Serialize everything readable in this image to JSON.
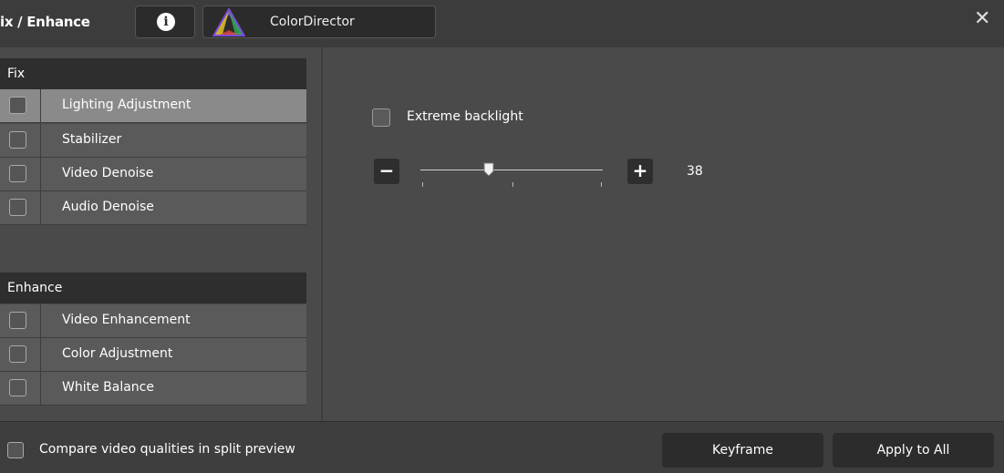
{
  "header": {
    "title": "ix / Enhance",
    "info_icon": "info-icon",
    "info_glyph": "i",
    "colordirector_label": "ColorDirector",
    "close_glyph": "✕"
  },
  "fix_section": {
    "header": "Fix",
    "items": [
      {
        "label": "Lighting Adjustment",
        "checked": false,
        "selected": true
      },
      {
        "label": "Stabilizer",
        "checked": false,
        "selected": false
      },
      {
        "label": "Video Denoise",
        "checked": false,
        "selected": false
      },
      {
        "label": "Audio Denoise",
        "checked": false,
        "selected": false
      }
    ]
  },
  "enhance_section": {
    "header": "Enhance",
    "items": [
      {
        "label": "Video Enhancement",
        "checked": false
      },
      {
        "label": "Color Adjustment",
        "checked": false
      },
      {
        "label": "White Balance",
        "checked": false
      }
    ]
  },
  "lighting_panel": {
    "extreme_backlight_label": "Extreme backlight",
    "extreme_backlight_checked": false,
    "minus_glyph": "−",
    "plus_glyph": "+",
    "slider_value": "38"
  },
  "footer": {
    "compare_label": "Compare video qualities in split preview",
    "compare_checked": false,
    "keyframe_label": "Keyframe",
    "apply_all_label": "Apply to All"
  },
  "colors": {
    "panel_bg": "#4a4a4a",
    "header_bg": "#2e2e2e",
    "selected_row": "#8a8a8a",
    "row_bg": "#5a5a5a",
    "button_bg": "#2c2c2c"
  }
}
